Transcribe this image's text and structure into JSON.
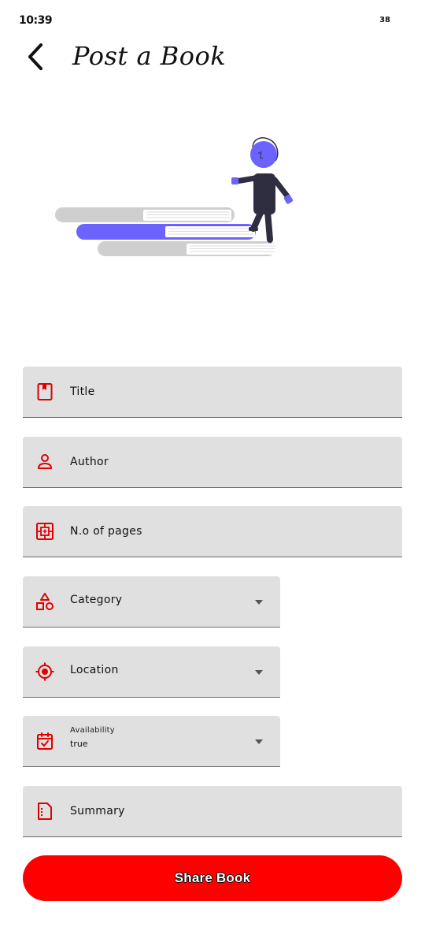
{
  "status_bar": {
    "time": "10:39",
    "indicator": "38"
  },
  "header": {
    "title": "Post a Book",
    "back_icon": "chevron-left-icon"
  },
  "illustration": {
    "name": "person-walking-on-books-illustration",
    "accent_color": "#6c63ff"
  },
  "form": {
    "title": {
      "label": "Title",
      "icon": "book-bookmark-icon"
    },
    "author": {
      "label": "Author",
      "icon": "person-icon"
    },
    "pages": {
      "label": "N.o of pages",
      "icon": "pages-grid-icon"
    },
    "category": {
      "label": "Category",
      "icon": "shapes-icon"
    },
    "location": {
      "label": "Location",
      "icon": "gps-target-icon"
    },
    "availability": {
      "label": "Availability",
      "value": "true",
      "icon": "calendar-check-icon"
    },
    "summary": {
      "label": "Summary",
      "icon": "document-icon"
    }
  },
  "submit": {
    "label": "Share Book"
  },
  "colors": {
    "accent": "#ff0000",
    "field_bg": "#e0e0e0",
    "icon": "#e00000"
  }
}
